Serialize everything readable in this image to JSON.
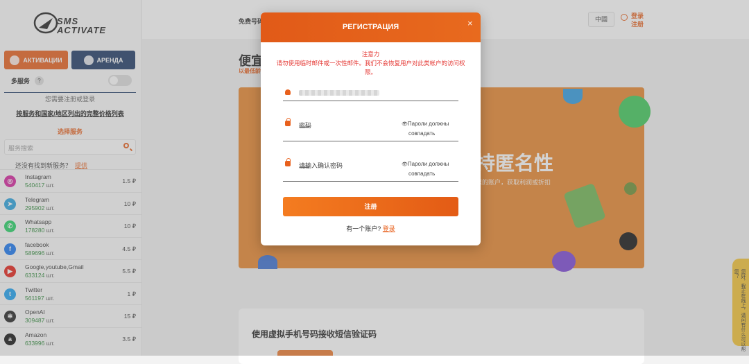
{
  "header": {
    "nav_link": "免费号码",
    "language": "中國",
    "login": "登录",
    "register": "注册"
  },
  "sidebar": {
    "logo_text_top": "SMS",
    "logo_text_bottom": "ACTIVATE",
    "tabs": [
      {
        "label": "АКТИВАЦИИ",
        "icon": "activation-icon"
      },
      {
        "label": "АРЕНДА",
        "icon": "rent-icon"
      }
    ],
    "multi_service_label": "多服务",
    "help_mark": "?",
    "login_required": "您需要注册或登录",
    "price_list_link": "按服务和国家/地区列出的完整价格列表",
    "select_service": "选择服务",
    "search_placeholder": "服务搜索",
    "not_found_text": "还没有找到新服务？",
    "not_found_link": "提供",
    "services": [
      {
        "name": "Instagram",
        "count": "540417",
        "unit": "шт.",
        "price": "1.5 ₽",
        "icon": "instagram-icon",
        "color": "#d6249f",
        "glyph": "◎"
      },
      {
        "name": "Telegram",
        "count": "295902",
        "unit": "шт.",
        "price": "10 ₽",
        "icon": "telegram-icon",
        "color": "#2aa3df",
        "glyph": "➤"
      },
      {
        "name": "Whatsapp",
        "count": "178280",
        "unit": "шт.",
        "price": "10 ₽",
        "icon": "whatsapp-icon",
        "color": "#25d366",
        "glyph": "✆"
      },
      {
        "name": "facebook",
        "count": "589696",
        "unit": "шт.",
        "price": "4.5 ₽",
        "icon": "facebook-icon",
        "color": "#1877f2",
        "glyph": "f"
      },
      {
        "name": "Google,youtube,Gmail",
        "count": "633124",
        "unit": "шт.",
        "price": "5.5 ₽",
        "icon": "youtube-icon",
        "color": "#e62117",
        "glyph": "▶"
      },
      {
        "name": "Twitter",
        "count": "561197",
        "unit": "шт.",
        "price": "1 ₽",
        "icon": "twitter-icon",
        "color": "#1da1f2",
        "glyph": "t"
      },
      {
        "name": "OpenAI",
        "count": "309487",
        "unit": "шт.",
        "price": "15 ₽",
        "icon": "openai-icon",
        "color": "#222222",
        "glyph": "✻"
      },
      {
        "name": "Amazon",
        "count": "633996",
        "unit": "шт.",
        "price": "3.5 ₽",
        "icon": "amazon-icon",
        "color": "#111111",
        "glyph": "a"
      }
    ]
  },
  "main": {
    "heading_fragment": "便宜",
    "subheading_fragment": "以最低龄",
    "hero_title": "持匿名性",
    "hero_subtitle": "您的账户，获取利润或折扣",
    "section_title": "使用虚拟手机号码接收短信验证码",
    "side_tab": "您好，我正在线上，请问有什么可以帮您？"
  },
  "modal": {
    "title": "РЕГИСТРАЦИЯ",
    "close_glyph": "×",
    "warning_title": "注意力",
    "warning_body": "请勿使用临时邮件或一次性邮件。我们不会恢复用户对此类帐户的访问权限。",
    "password_label": "密码",
    "confirm_label": "请输入确认密码",
    "password_dots": "••••••••",
    "mismatch_line1": "Пароли должны",
    "mismatch_line2": "совпадать",
    "eye_glyph": "👁",
    "submit_label": "注册",
    "have_account": "有一个账户?",
    "login_link": "登录"
  },
  "colors": {
    "accent": "#e8601c",
    "navy": "#1e3a66",
    "error": "#e53935",
    "hero": "#e8862d"
  }
}
